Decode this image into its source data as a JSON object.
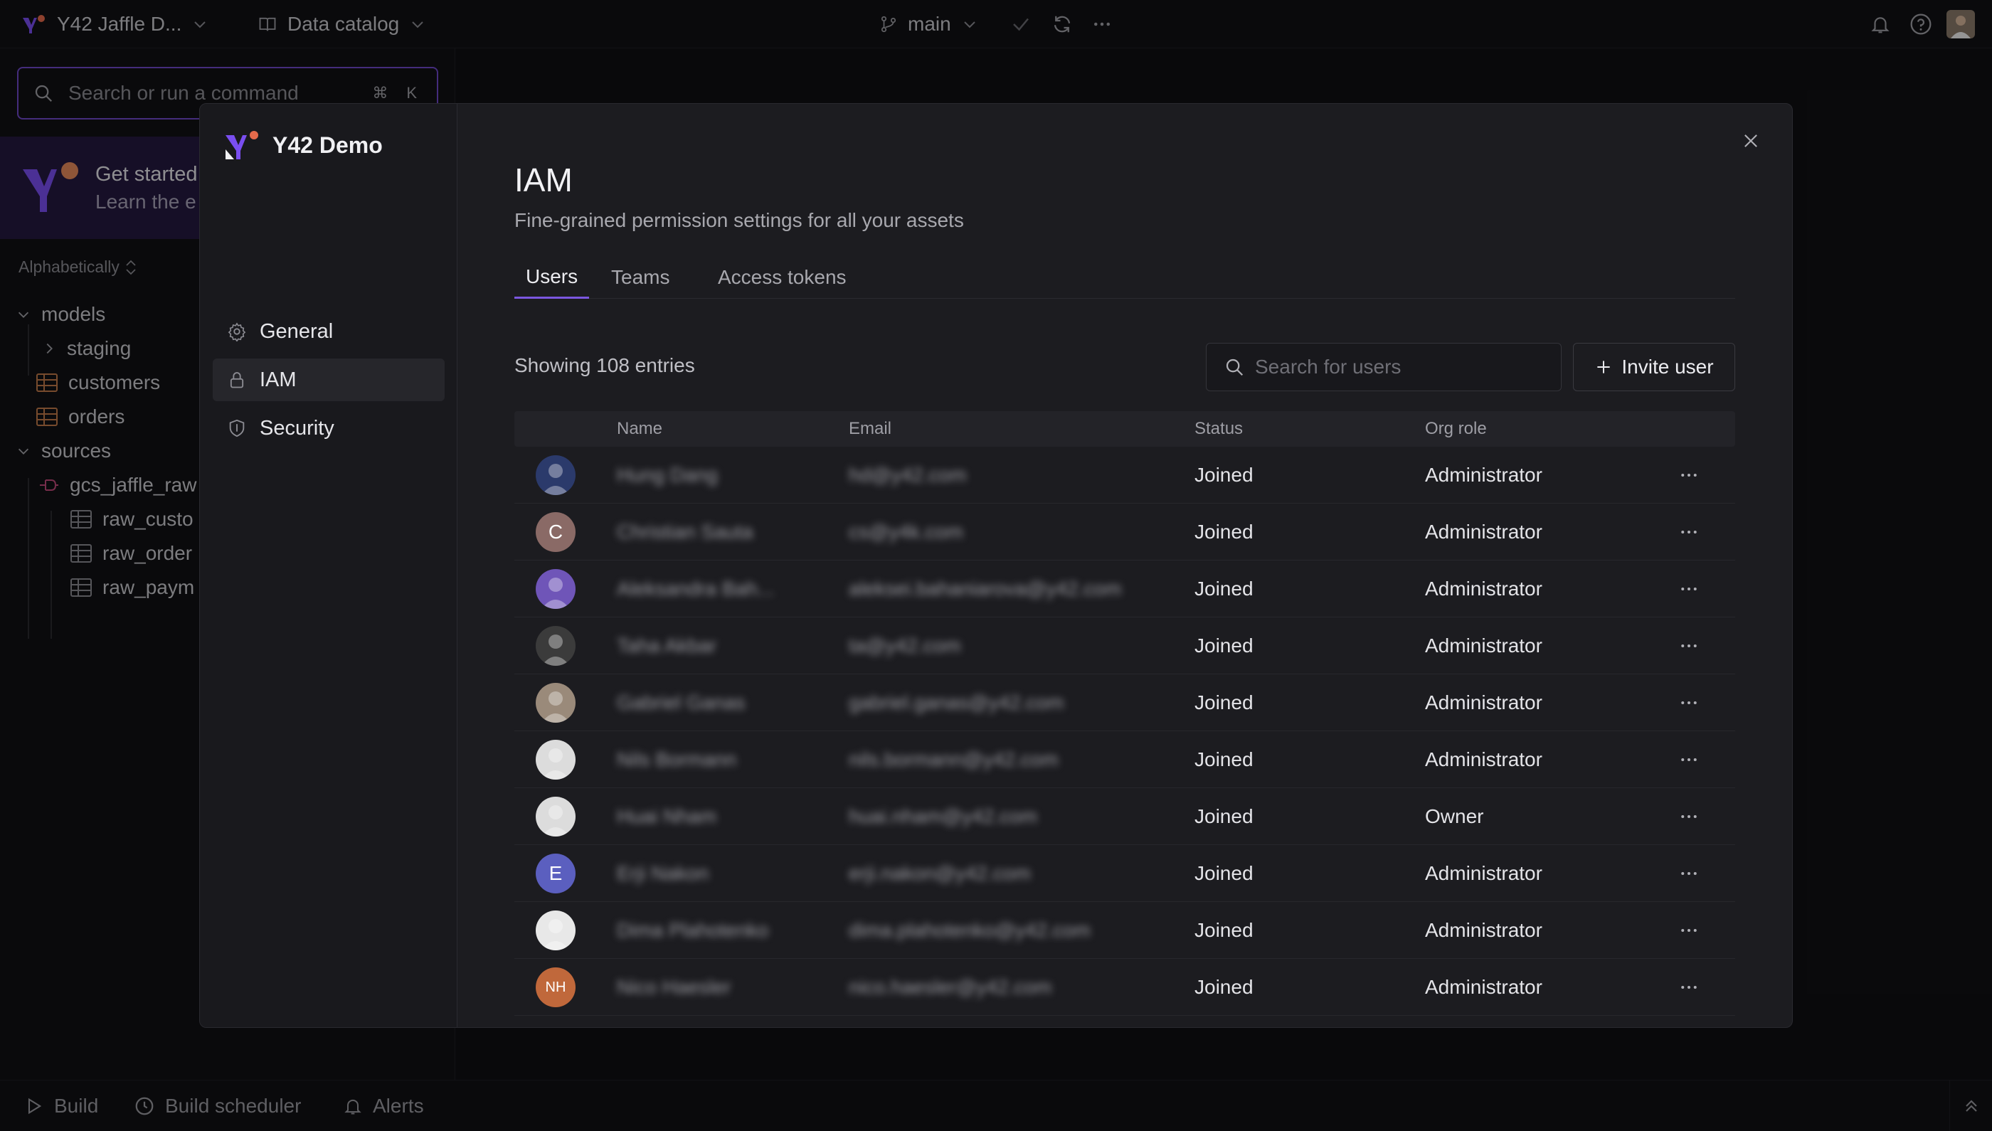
{
  "topbar": {
    "project": "Y42 Jaffle D...",
    "section": "Data catalog",
    "branch": "main"
  },
  "sidebar": {
    "search_placeholder": "Search or run a command",
    "shortcut_cmd": "⌘",
    "shortcut_key": "K",
    "get_started_title": "Get started",
    "get_started_sub": "Learn the e",
    "sort_label": "Alphabetically",
    "tree": [
      {
        "label": "models"
      },
      {
        "label": "staging"
      },
      {
        "label": "customers"
      },
      {
        "label": "orders"
      },
      {
        "label": "sources"
      },
      {
        "label": "gcs_jaffle_raw"
      },
      {
        "label": "raw_custo"
      },
      {
        "label": "raw_order"
      },
      {
        "label": "raw_paym"
      }
    ]
  },
  "bottombar": {
    "build": "Build",
    "scheduler": "Build scheduler",
    "alerts": "Alerts"
  },
  "modal": {
    "workspace": "Y42 Demo",
    "nav": [
      {
        "label": "General"
      },
      {
        "label": "IAM"
      },
      {
        "label": "Security"
      }
    ],
    "title": "IAM",
    "subtitle": "Fine-grained permission settings for all your assets",
    "tabs": [
      {
        "label": "Users"
      },
      {
        "label": "Teams"
      },
      {
        "label": "Access tokens"
      }
    ],
    "entries": "Showing 108 entries",
    "search_placeholder": "Search for users",
    "invite_label": "Invite user",
    "columns": {
      "name": "Name",
      "email": "Email",
      "status": "Status",
      "role": "Org role"
    },
    "users": [
      {
        "initials": "",
        "avatar_color": "#2b3a6b",
        "name": "Hung Dang",
        "email": "hd@y42.com",
        "status": "Joined",
        "role": "Administrator"
      },
      {
        "initials": "C",
        "avatar_color": "#8a6a66",
        "name": "Christian Sauta",
        "email": "cs@y4k.com",
        "status": "Joined",
        "role": "Administrator"
      },
      {
        "initials": "",
        "avatar_color": "#6f55b8",
        "name": "Aleksandra Bah...",
        "email": "aleksei.bahaniarova@y42.com",
        "status": "Joined",
        "role": "Administrator"
      },
      {
        "initials": "",
        "avatar_color": "#3b3b3b",
        "name": "Taha Akbar",
        "email": "ta@y42.com",
        "status": "Joined",
        "role": "Administrator"
      },
      {
        "initials": "",
        "avatar_color": "#9a8a7a",
        "name": "Gabriel Ganas",
        "email": "gabriel.ganas@y42.com",
        "status": "Joined",
        "role": "Administrator"
      },
      {
        "initials": "",
        "avatar_color": "#dcdcdc",
        "name": "Nils Bormann",
        "email": "nils.bormann@y42.com",
        "status": "Joined",
        "role": "Administrator"
      },
      {
        "initials": "",
        "avatar_color": "#dcdcdc",
        "name": "Huai Nham",
        "email": "huai.nham@y42.com",
        "status": "Joined",
        "role": "Owner"
      },
      {
        "initials": "E",
        "avatar_color": "#5b5fbf",
        "name": "Erji Nakon",
        "email": "erji.nakon@y42.com",
        "status": "Joined",
        "role": "Administrator"
      },
      {
        "initials": "",
        "avatar_color": "#e8e8e8",
        "name": "Dima Plahotenko",
        "email": "dima.plahotenko@y42.com",
        "status": "Joined",
        "role": "Administrator"
      },
      {
        "initials": "NH",
        "avatar_color": "#c0683b",
        "name": "Nico Haesler",
        "email": "nico.haesler@y42.com",
        "status": "Joined",
        "role": "Administrator"
      }
    ]
  }
}
